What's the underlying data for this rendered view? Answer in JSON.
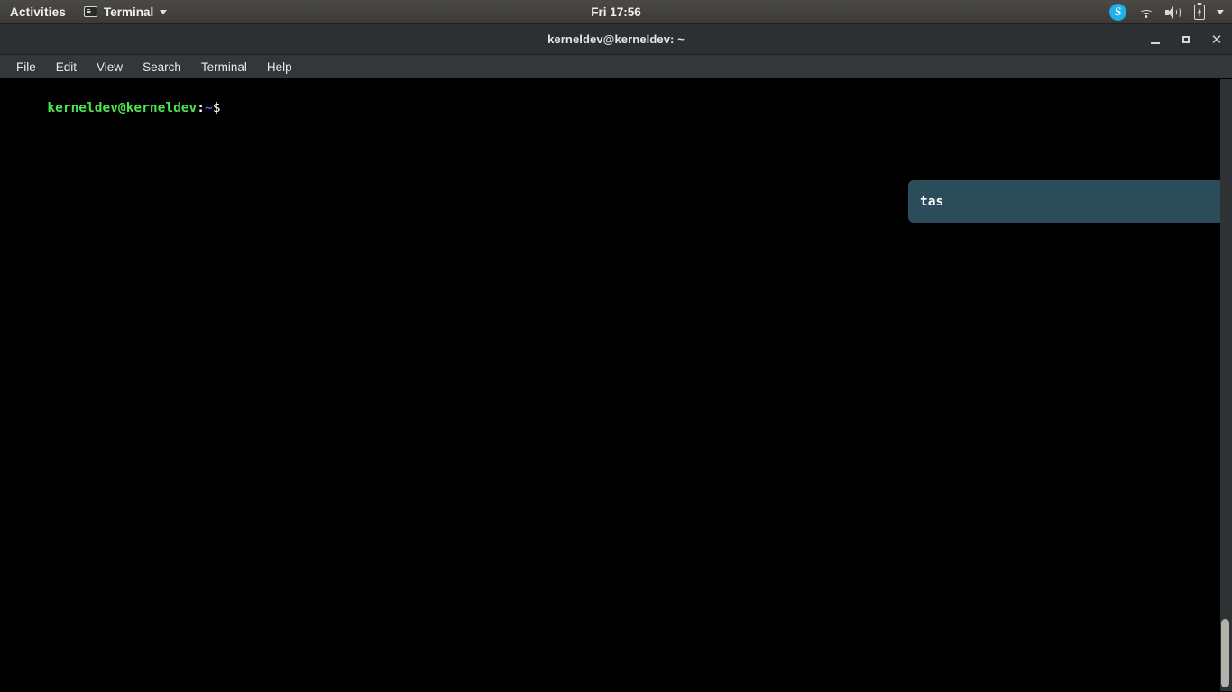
{
  "top_bar": {
    "activities_label": "Activities",
    "app_menu": {
      "label": "Terminal",
      "icon": "terminal-icon",
      "caret": "chevron-down-icon"
    },
    "clock": "Fri 17:56",
    "tray": [
      {
        "name": "skype-icon",
        "glyph": "S"
      },
      {
        "name": "wifi-icon"
      },
      {
        "name": "volume-icon"
      },
      {
        "name": "battery-charging-icon"
      },
      {
        "name": "system-menu-chevron-icon"
      }
    ],
    "colors": {
      "background_top": "#4b4945",
      "background_bottom": "#3b3a37",
      "text": "#f2f0ee",
      "skype_blue": "#24b0e8"
    }
  },
  "window": {
    "title": "kerneldev@kerneldev: ~",
    "controls": {
      "minimize": "minimize-button",
      "maximize": "maximize-button",
      "close": "close-button"
    },
    "colors": {
      "titlebar": "#2c3033",
      "menubar": "#32373a",
      "terminal_background": "#000000"
    }
  },
  "menu_bar": {
    "items": [
      {
        "label": "File"
      },
      {
        "label": "Edit"
      },
      {
        "label": "View"
      },
      {
        "label": "Search"
      },
      {
        "label": "Terminal"
      },
      {
        "label": "Help"
      }
    ]
  },
  "terminal": {
    "prompt": {
      "user_host": "kerneldev@kerneldev",
      "colon": ":",
      "path": "~",
      "symbol": "$",
      "colors": {
        "user_host": "#4ee44e",
        "path": "#5c5cff",
        "symbol": "#ffffff"
      }
    },
    "completion_popup": {
      "text": "tas",
      "background": "#2b4c59",
      "text_color": "#ffffff"
    },
    "scrollbar": {
      "track_color": "#2e3235",
      "thumb_color": "#b4b0ac"
    }
  }
}
